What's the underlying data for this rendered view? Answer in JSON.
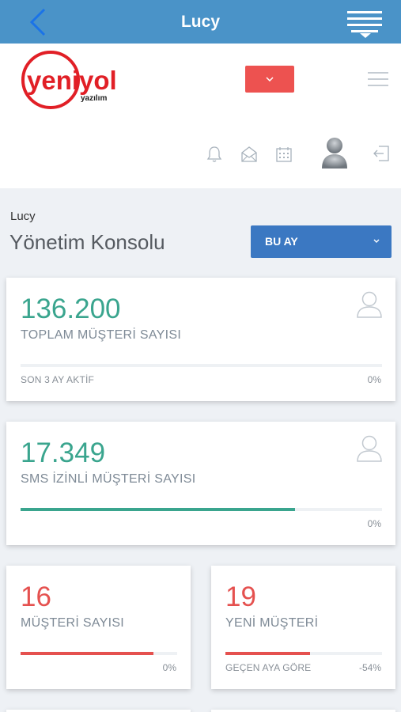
{
  "navbar": {
    "title": "Lucy"
  },
  "header": {
    "logo_text_main": "yeniyol",
    "logo_text_sub": "yazılım",
    "icons": [
      "bell-icon",
      "envelope-open-icon",
      "calendar-icon",
      "avatar",
      "logout-icon"
    ]
  },
  "page": {
    "breadcrumb": "Lucy",
    "title": "Yönetim Konsolu",
    "range_select": "BU AY"
  },
  "colors": {
    "nav_blue": "#4a93c8",
    "select_blue": "#3b78c2",
    "red": "#e5514f",
    "green": "#3aa58e"
  },
  "cards": [
    {
      "value": "136.200",
      "label": "TOPLAM MÜŞTERİ SAYISI",
      "footer": "SON 3 AY AKTİF",
      "percent": "0%",
      "progress": 0,
      "color": "green"
    },
    {
      "value": "17.349",
      "label": "SMS İZİNLİ MÜŞTERİ SAYISI",
      "footer": "",
      "percent": "0%",
      "progress": 0.76,
      "color": "green"
    },
    {
      "value": "16",
      "label": "MÜŞTERİ SAYISI",
      "footer": "",
      "percent": "0%",
      "progress": 0.85,
      "color": "red"
    },
    {
      "value": "19",
      "label": "YENİ MÜŞTERİ",
      "footer": "GEÇEN AYA GÖRE",
      "percent": "-54%",
      "progress": 0.54,
      "color": "red"
    }
  ]
}
